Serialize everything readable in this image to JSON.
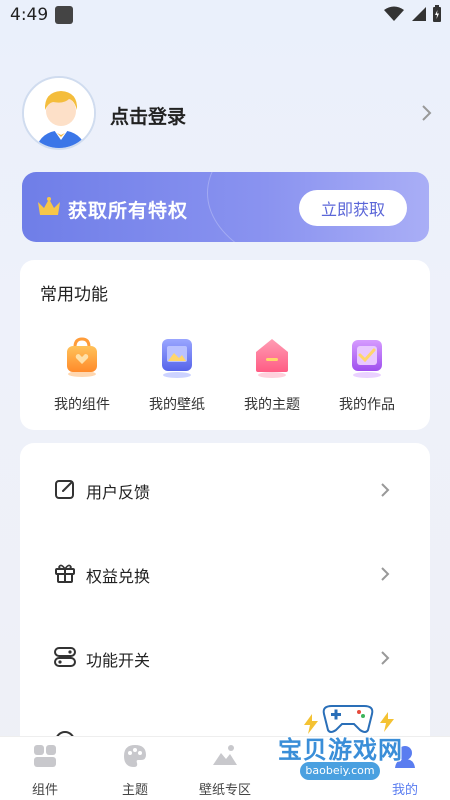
{
  "status_bar": {
    "time": "4:49"
  },
  "profile": {
    "login_text": "点击登录"
  },
  "vip_banner": {
    "title": "获取所有特权",
    "button_label": "立即获取",
    "accent": "#6f7ee8"
  },
  "features": {
    "title": "常用功能",
    "items": [
      {
        "label": "我的组件",
        "icon": "bag-icon",
        "color": "#ff9c3a"
      },
      {
        "label": "我的壁纸",
        "icon": "picture-icon",
        "color": "#6b78f0"
      },
      {
        "label": "我的主题",
        "icon": "house-icon",
        "color": "#ff6f91"
      },
      {
        "label": "我的作品",
        "icon": "check-icon",
        "color": "#b36af0"
      }
    ]
  },
  "menu": {
    "items": [
      {
        "label": "用户反馈",
        "icon": "edit-icon"
      },
      {
        "label": "权益兑换",
        "icon": "gift-icon"
      },
      {
        "label": "功能开关",
        "icon": "toggle-icon"
      }
    ]
  },
  "bottom_nav": {
    "items": [
      {
        "label": "组件",
        "icon": "widget-icon"
      },
      {
        "label": "主题",
        "icon": "palette-icon"
      },
      {
        "label": "壁纸专区",
        "icon": "mountain-icon"
      },
      {
        "label": "我的",
        "icon": "profile-icon",
        "active": true
      }
    ],
    "active_color": "#5a7df0"
  },
  "watermark": {
    "title": "宝贝游戏网",
    "url": "baobeiy.com"
  }
}
